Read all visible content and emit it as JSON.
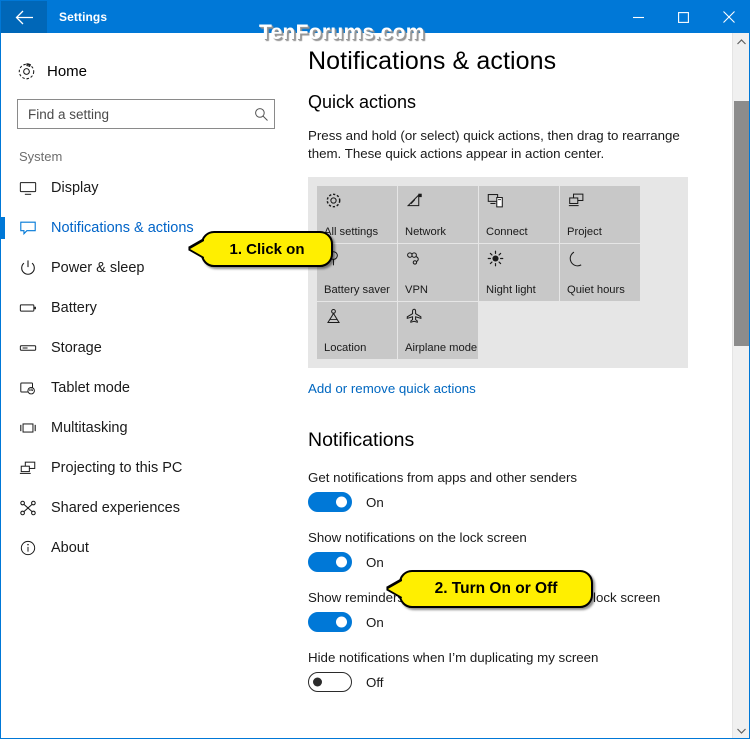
{
  "window": {
    "title": "Settings",
    "back_icon": "arrow-left-icon",
    "minimize_label": "─",
    "maximize_label": "□",
    "close_label": "✕"
  },
  "watermark": "TenForums.com",
  "sidebar": {
    "home": {
      "label": "Home",
      "icon": "gear-icon"
    },
    "search": {
      "placeholder": "Find a setting",
      "value": "",
      "icon": "search-icon"
    },
    "group_label": "System",
    "items": [
      {
        "label": "Display",
        "icon": "monitor-icon",
        "selected": false
      },
      {
        "label": "Notifications & actions",
        "icon": "speech-bubble-icon",
        "selected": true
      },
      {
        "label": "Power & sleep",
        "icon": "power-icon",
        "selected": false
      },
      {
        "label": "Battery",
        "icon": "battery-icon",
        "selected": false
      },
      {
        "label": "Storage",
        "icon": "drive-icon",
        "selected": false
      },
      {
        "label": "Tablet mode",
        "icon": "tablet-hand-icon",
        "selected": false
      },
      {
        "label": "Multitasking",
        "icon": "multitask-icon",
        "selected": false
      },
      {
        "label": "Projecting to this PC",
        "icon": "project-screens-icon",
        "selected": false
      },
      {
        "label": "Shared experiences",
        "icon": "share-nodes-icon",
        "selected": false
      },
      {
        "label": "About",
        "icon": "info-icon",
        "selected": false
      }
    ]
  },
  "main": {
    "page_title": "Notifications & actions",
    "quick_actions": {
      "heading": "Quick actions",
      "description": "Press and hold (or select) quick actions, then drag to rearrange them. These quick actions appear in action center.",
      "tiles": [
        {
          "label": "All settings",
          "icon": "gear-icon"
        },
        {
          "label": "Network",
          "icon": "wifi-icon"
        },
        {
          "label": "Connect",
          "icon": "connect-icon"
        },
        {
          "label": "Project",
          "icon": "project-icon"
        },
        {
          "label": "Battery saver",
          "icon": "battery-saver-icon"
        },
        {
          "label": "VPN",
          "icon": "vpn-icon"
        },
        {
          "label": "Night light",
          "icon": "sun-icon"
        },
        {
          "label": "Quiet hours",
          "icon": "moon-icon"
        },
        {
          "label": "Location",
          "icon": "location-icon"
        },
        {
          "label": "Airplane mode",
          "icon": "airplane-icon"
        }
      ],
      "link": "Add or remove quick actions"
    },
    "notifications": {
      "heading": "Notifications",
      "settings": [
        {
          "label": "Get notifications from apps and other senders",
          "state": "On",
          "on": true
        },
        {
          "label": "Show notifications on the lock screen",
          "state": "On",
          "on": true
        },
        {
          "label": "Show reminders and incoming VoIP calls on the lock screen",
          "state": "On",
          "on": true
        },
        {
          "label": "Hide notifications when I’m duplicating my screen",
          "state": "Off",
          "on": false
        }
      ]
    }
  },
  "callouts": [
    {
      "text": "1. Click on"
    },
    {
      "text": "2. Turn On or Off"
    }
  ],
  "colors": {
    "accent": "#0078d7",
    "titlebar": "#0078d7",
    "link": "#0067c0",
    "callout_fill": "#ffef00",
    "tile_bg": "#c8c8c8",
    "panel_bg": "#e6e6e6"
  }
}
